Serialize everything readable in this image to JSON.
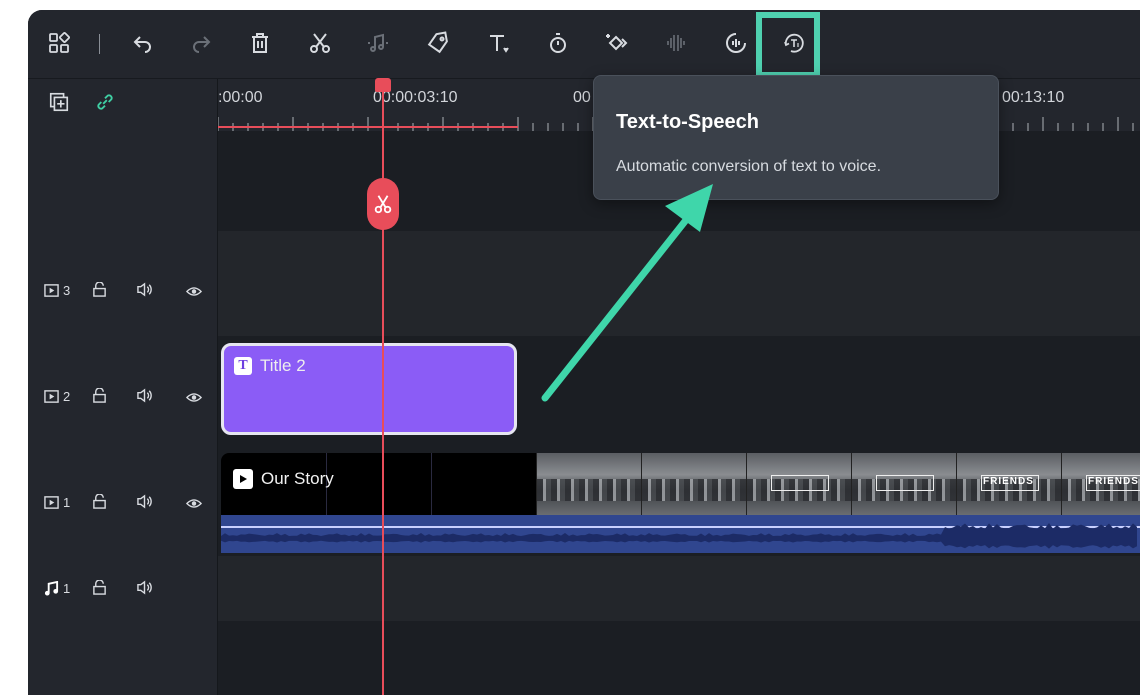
{
  "toolbar": {
    "icons": [
      "layout-grid-icon",
      "undo-icon",
      "redo-icon",
      "delete-icon",
      "scissors-icon",
      "audio-split-icon",
      "tag-icon",
      "text-icon",
      "timer-icon",
      "keyframe-icon",
      "audio-wave-icon",
      "voice-icon",
      "text-to-speech-icon"
    ]
  },
  "ruler": {
    "timecodes": [
      ":00:00",
      "00:00:03:10",
      "00",
      "00:13:10"
    ]
  },
  "tooltip": {
    "title": "Text-to-Speech",
    "description": "Automatic conversion of text to voice."
  },
  "tracks": [
    {
      "label": "3",
      "type": "video"
    },
    {
      "label": "2",
      "type": "video"
    },
    {
      "label": "1",
      "type": "video"
    },
    {
      "label": "1",
      "type": "audio"
    }
  ],
  "clips": {
    "title_clip": "Title 2",
    "video_clip": "Our Story",
    "thumb_text": "FRIENDS"
  },
  "colors": {
    "accent_highlight": "#4fd1b0",
    "playhead": "#e84d5a",
    "title_clip": "#8b5cf6",
    "audio_wave": "#30468f"
  }
}
